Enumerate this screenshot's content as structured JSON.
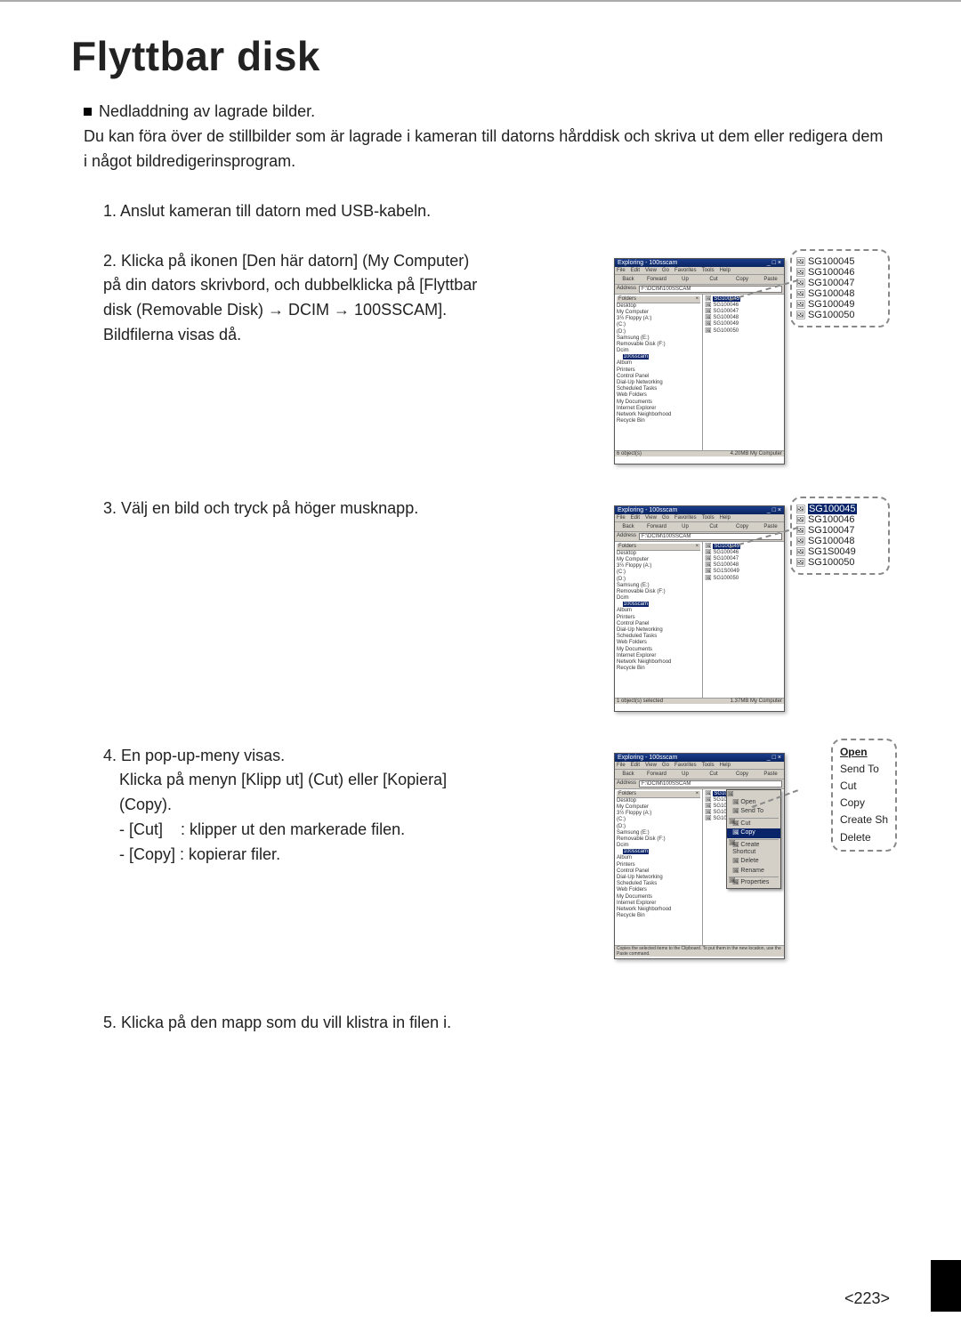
{
  "title": "Flyttbar disk",
  "intro_heading": "Nedladdning av lagrade bilder.",
  "intro_body": "Du kan föra över de stillbilder som är lagrade i kameran till datorns hårddisk och skriva ut dem eller redigera dem i något bildredigerinsprogram.",
  "step1": "1. Anslut kameran till datorn med USB-kabeln.",
  "step2": "2. Klicka på ikonen [Den här datorn] (My Computer) på din dators skrivbord, och dubbelklicka på [Flyttbar disk (Removable Disk) → DCIM → 100SSCAM]. Bildfilerna visas då.",
  "step3": "3. Välj en bild och tryck på höger musknapp.",
  "step4_a": "4. En pop-up-meny visas.",
  "step4_b": "Klicka på menyn [Klipp ut] (Cut) eller [Kopiera] (Copy).",
  "step4_c": "- [Cut]    : klipper ut den markerade filen.",
  "step4_d": "- [Copy] : kopierar filer.",
  "step5": "5. Klicka på den mapp som du vill klistra in filen i.",
  "pagenum": "<223>",
  "win": {
    "title": "Exploring - 100sscam",
    "menus": [
      "File",
      "Edit",
      "View",
      "Go",
      "Favorites",
      "Tools",
      "Help"
    ],
    "tools": [
      "Back",
      "Forward",
      "Up",
      "Cut",
      "Copy",
      "Paste"
    ],
    "addr_lbl": "Address",
    "addr_val": "F:\\DCIM\\100SSCAM",
    "folders_hdr": "Folders",
    "tree": [
      "Desktop",
      " My Computer",
      "  3½ Floppy (A:)",
      "  (C:)",
      "  (D:)",
      "  Samsung (E:)",
      "  Removable Disk (F:)",
      "   Dcim",
      "    100sscam",
      "   Album",
      " Printers",
      " Control Panel",
      " Dial-Up Networking",
      " Scheduled Tasks",
      " Web Folders",
      " My Documents",
      " Internet Explorer",
      " Network Neighborhood",
      " Recycle Bin"
    ],
    "files2": [
      "SG100045",
      "SG100046",
      "SG100047",
      "SG100048",
      "SG100049",
      "SG100050"
    ],
    "files3": [
      "SG100045",
      "SG100046",
      "SG100047",
      "SG100048",
      "SG1S0049",
      "SG100050"
    ],
    "files4": [
      "SG10",
      "SG10",
      "SG10",
      "SG10",
      "SG10"
    ],
    "status2_l": "6 object(s)",
    "status2_r": "4.20MB  My Computer",
    "status3_l": "1 object(s) selected",
    "status3_r": "1.37MB  My Computer",
    "status4": "Copies the selected items to the Clipboard. To put them in the new location, use the Paste command."
  },
  "callout2": [
    "SG100045",
    "SG100046",
    "SG100047",
    "SG100048",
    "SG100049",
    "SG100050"
  ],
  "callout3": [
    "SG100045",
    "SG100046",
    "SG100047",
    "SG100048",
    "SG1S0049",
    "SG100050"
  ],
  "ctx": [
    "Open",
    "Send To",
    "Cut",
    "Copy",
    "Create Shortcut",
    "Delete",
    "Rename",
    "Properties"
  ],
  "ctxR": [
    "Open",
    "Send To",
    "Cut",
    "Copy",
    "Create Sh",
    "Delete"
  ]
}
